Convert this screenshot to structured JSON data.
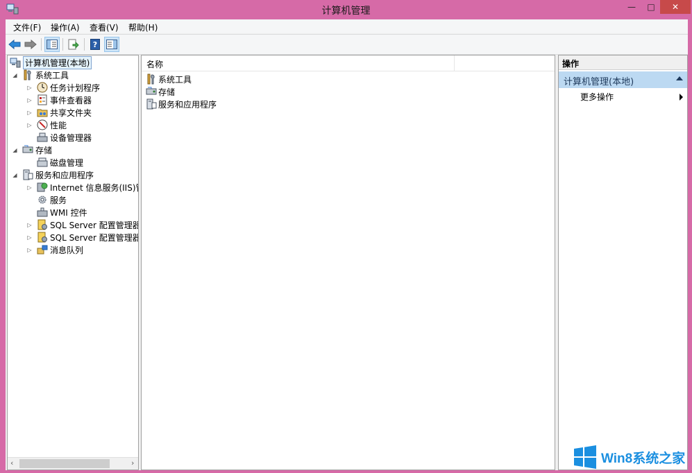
{
  "window": {
    "title": "计算机管理"
  },
  "menubar": {
    "items": [
      "文件(F)",
      "操作(A)",
      "查看(V)",
      "帮助(H)"
    ]
  },
  "toolbar": {
    "buttons": [
      "back-arrow-icon",
      "forward-arrow-icon",
      "show-tree-icon",
      "export-list-icon",
      "help-icon",
      "show-action-pane-icon"
    ]
  },
  "tree": {
    "root": "计算机管理(本地)",
    "items": [
      {
        "label": "系统工具",
        "level": 1,
        "expander": "expanded"
      },
      {
        "label": "任务计划程序",
        "level": 2,
        "expander": "collapsed"
      },
      {
        "label": "事件查看器",
        "level": 2,
        "expander": "collapsed"
      },
      {
        "label": "共享文件夹",
        "level": 2,
        "expander": "collapsed"
      },
      {
        "label": "性能",
        "level": 2,
        "expander": "collapsed"
      },
      {
        "label": "设备管理器",
        "level": 2,
        "expander": "none"
      },
      {
        "label": "存储",
        "level": 1,
        "expander": "expanded"
      },
      {
        "label": "磁盘管理",
        "level": 2,
        "expander": "none"
      },
      {
        "label": "服务和应用程序",
        "level": 1,
        "expander": "expanded"
      },
      {
        "label": "Internet 信息服务(IIS)管",
        "level": 2,
        "expander": "collapsed"
      },
      {
        "label": "服务",
        "level": 2,
        "expander": "none"
      },
      {
        "label": "WMI 控件",
        "level": 2,
        "expander": "none"
      },
      {
        "label": "SQL Server 配置管理器",
        "level": 2,
        "expander": "collapsed"
      },
      {
        "label": "SQL Server 配置管理器",
        "level": 2,
        "expander": "collapsed"
      },
      {
        "label": "消息队列",
        "level": 2,
        "expander": "collapsed"
      }
    ]
  },
  "list": {
    "column_name": "名称",
    "rows": [
      "系统工具",
      "存储",
      "服务和应用程序"
    ]
  },
  "actions": {
    "header": "操作",
    "group_title": "计算机管理(本地)",
    "more_actions": "更多操作"
  },
  "watermark": {
    "text": "Win8系统之家"
  },
  "colors": {
    "frame": "#d66aa7",
    "accent": "#1b8fe0",
    "selection": "#e5f3fb",
    "action_group": "#bcd9f2"
  }
}
